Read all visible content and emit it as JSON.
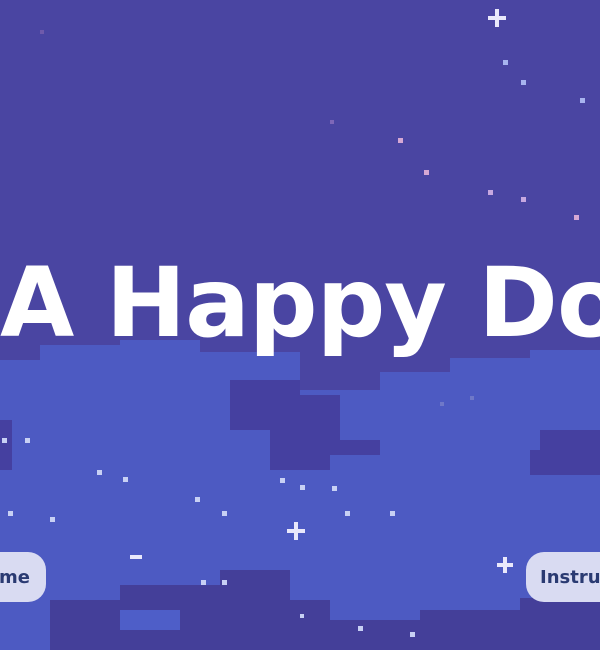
{
  "game": {
    "title": "A Happy Dot"
  },
  "menu": {
    "left_button_label": "me",
    "right_button_label": "Instruc"
  },
  "colors": {
    "sky": "#4a45a2",
    "cloud_light": "#4d5ac2",
    "cloud_dark": "#434d9e",
    "button_bg": "#d9dbf2",
    "button_text": "#2a3a72",
    "title_text": "#ffffff"
  }
}
